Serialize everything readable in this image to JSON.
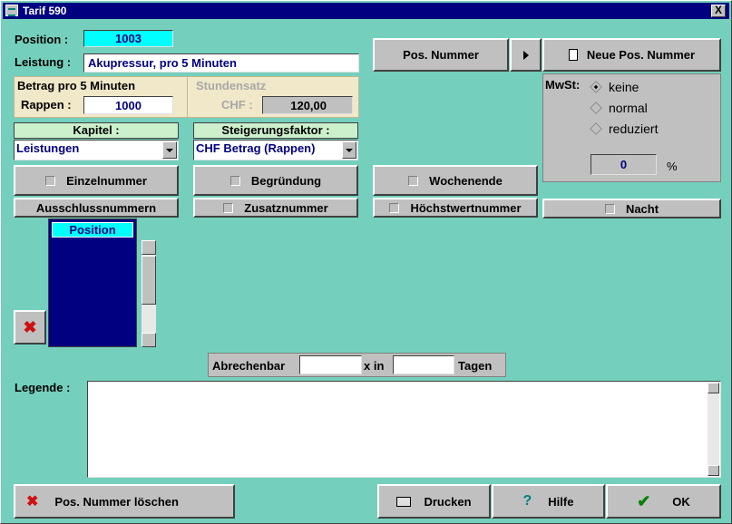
{
  "window": {
    "title": "Tarif 590",
    "close_label": "X"
  },
  "position": {
    "label": "Position :",
    "value": "1003"
  },
  "leistung": {
    "label": "Leistung :",
    "value": "Akupressur, pro 5 Minuten"
  },
  "betrag": {
    "title": "Betrag pro 5 Minuten",
    "rappen_label": "Rappen :",
    "rappen_value": "1000"
  },
  "stundensatz": {
    "title": "Stundensatz",
    "chf_label": "CHF :",
    "chf_value": "120,00"
  },
  "kapitel": {
    "label": "Kapitel :",
    "value": "Leistungen"
  },
  "steigerung": {
    "label": "Steigerungsfaktor :",
    "value": "CHF Betrag (Rappen)"
  },
  "buttons": {
    "pos_nummer": "Pos. Nummer",
    "neue_pos": "Neue Pos. Nummer",
    "einzelnummer": "Einzelnummer",
    "begruendung": "Begründung",
    "wochenende": "Wochenende",
    "ausschluss": "Ausschlussnummern",
    "zusatz": "Zusatznummer",
    "hoechstwert": "Höchstwertnummer",
    "nacht": "Nacht",
    "loeschen": "Pos. Nummer löschen",
    "drucken": "Drucken",
    "hilfe": "Hilfe",
    "ok": "OK"
  },
  "mwst": {
    "label": "MwSt:",
    "options": [
      "keine",
      "normal",
      "reduziert"
    ],
    "selected": "keine",
    "percent_value": "0",
    "percent_sign": "%"
  },
  "list": {
    "header": "Position"
  },
  "abrechenbar": {
    "label": "Abrechenbar",
    "x_value": "",
    "mid_label": "x in",
    "days_value": "",
    "days_label": "Tagen"
  },
  "legende": {
    "label": "Legende :",
    "value": ""
  },
  "colors": {
    "background": "#74d0bc",
    "titlebar": "#000080",
    "list_bg": "#000080",
    "position_field": "#00ffff"
  },
  "icons": [
    "window-icon",
    "close-icon",
    "arrow-right-icon",
    "document-icon",
    "delete-x-icon",
    "printer-icon",
    "help-icon",
    "checkmark-icon"
  ]
}
